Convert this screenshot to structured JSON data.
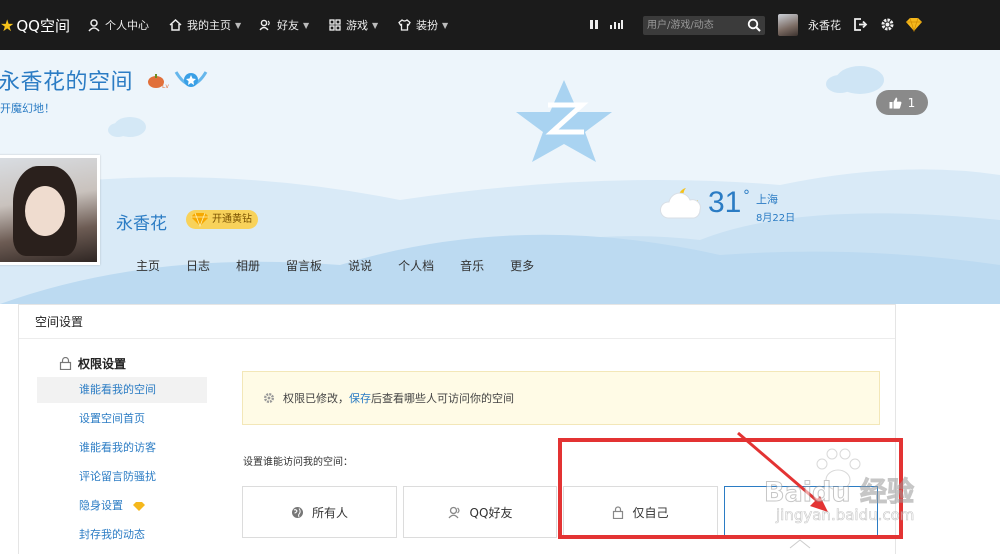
{
  "topbar": {
    "logo": "QQ空间",
    "nav": [
      {
        "label": "个人中心",
        "icon": "person-icon"
      },
      {
        "label": "我的主页",
        "icon": "home-icon"
      },
      {
        "label": "好友",
        "icon": "friends-icon"
      },
      {
        "label": "游戏",
        "icon": "grid-icon"
      },
      {
        "label": "装扮",
        "icon": "shirt-icon"
      }
    ],
    "search_placeholder": "用户/游戏/动态",
    "username": "永香花"
  },
  "header": {
    "space_title": "永香花的空间",
    "subtitle": "开魔幻地！",
    "likes": "1",
    "profile_name": "永香花",
    "vip_button": "开通黄钻",
    "tabs": [
      "主页",
      "日志",
      "相册",
      "留言板",
      "说说",
      "个人档",
      "音乐",
      "更多"
    ],
    "weather": {
      "temp": "31",
      "unit": "°",
      "city": "上海",
      "date": "8月22日"
    }
  },
  "settings": {
    "title": "空间设置",
    "section": "权限设置",
    "menu": [
      "谁能看我的空间",
      "设置空间首页",
      "谁能看我的访客",
      "评论留言防骚扰",
      "隐身设置",
      "封存我的动态"
    ],
    "notice_prefix": "权限已修改，",
    "notice_link": "保存",
    "notice_suffix": "后查看哪些人可访问你的空间",
    "access_label": "设置谁能访问我的空间：",
    "options": [
      "所有人",
      "QQ好友",
      "仅自己"
    ]
  },
  "watermark": {
    "brand": "Baidu 经验",
    "url": "jingyan.baidu.com"
  },
  "colors": {
    "topbar": "#1b1b1b",
    "accent": "#2b7cc4",
    "highlight": "#e33333"
  }
}
